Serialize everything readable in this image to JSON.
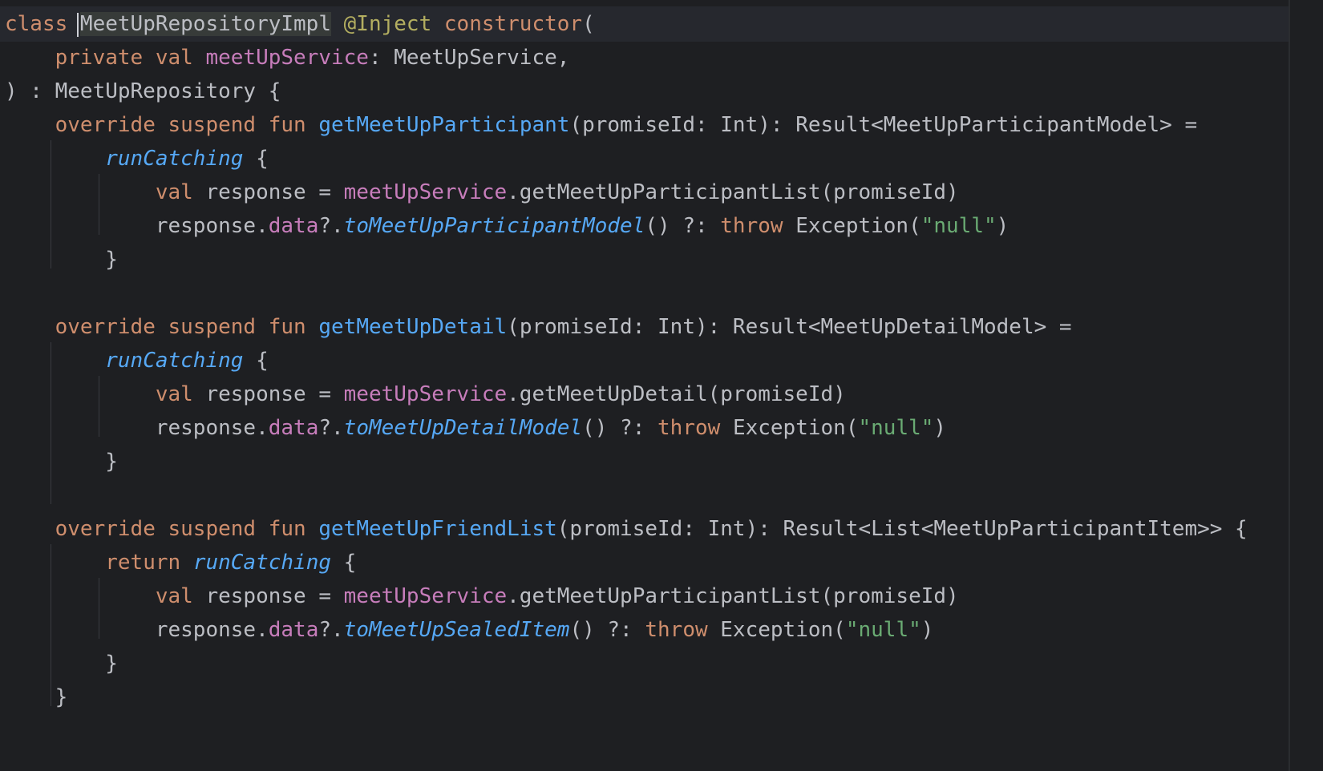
{
  "code_lines": [
    [
      {
        "t": "class ",
        "c": "kw"
      },
      {
        "t": "MeetUpRepositoryImpl",
        "c": "plain hl-word"
      },
      {
        "t": " ",
        "c": "plain"
      },
      {
        "t": "@Inject",
        "c": "ann"
      },
      {
        "t": " ",
        "c": "plain"
      },
      {
        "t": "constructor",
        "c": "kw"
      },
      {
        "t": "(",
        "c": "plain"
      }
    ],
    [
      {
        "t": "    ",
        "c": "plain"
      },
      {
        "t": "private val ",
        "c": "kw"
      },
      {
        "t": "meetUpService",
        "c": "prop"
      },
      {
        "t": ": MeetUpService,",
        "c": "plain"
      }
    ],
    [
      {
        "t": ") : MeetUpRepository {",
        "c": "plain"
      }
    ],
    [
      {
        "t": "    ",
        "c": "plain"
      },
      {
        "t": "override suspend fun ",
        "c": "kw"
      },
      {
        "t": "getMeetUpParticipant",
        "c": "fn"
      },
      {
        "t": "(promiseId: Int): Result<MeetUpParticipantModel> =",
        "c": "plain"
      }
    ],
    [
      {
        "t": "        ",
        "c": "plain"
      },
      {
        "t": "runCatching",
        "c": "ext"
      },
      {
        "t": " {",
        "c": "plain"
      }
    ],
    [
      {
        "t": "            ",
        "c": "plain"
      },
      {
        "t": "val ",
        "c": "kw"
      },
      {
        "t": "response = ",
        "c": "plain"
      },
      {
        "t": "meetUpService",
        "c": "prop"
      },
      {
        "t": ".getMeetUpParticipantList(promiseId)",
        "c": "plain"
      }
    ],
    [
      {
        "t": "            response.",
        "c": "plain"
      },
      {
        "t": "data",
        "c": "prop"
      },
      {
        "t": "?.",
        "c": "plain"
      },
      {
        "t": "toMeetUpParticipantModel",
        "c": "ext"
      },
      {
        "t": "() ?: ",
        "c": "plain"
      },
      {
        "t": "throw ",
        "c": "kw"
      },
      {
        "t": "Exception(",
        "c": "plain"
      },
      {
        "t": "\"null\"",
        "c": "str"
      },
      {
        "t": ")",
        "c": "plain"
      }
    ],
    [
      {
        "t": "        }",
        "c": "plain"
      }
    ],
    [],
    [
      {
        "t": "    ",
        "c": "plain"
      },
      {
        "t": "override suspend fun ",
        "c": "kw"
      },
      {
        "t": "getMeetUpDetail",
        "c": "fn"
      },
      {
        "t": "(promiseId: Int): Result<MeetUpDetailModel> =",
        "c": "plain"
      }
    ],
    [
      {
        "t": "        ",
        "c": "plain"
      },
      {
        "t": "runCatching",
        "c": "ext"
      },
      {
        "t": " {",
        "c": "plain"
      }
    ],
    [
      {
        "t": "            ",
        "c": "plain"
      },
      {
        "t": "val ",
        "c": "kw"
      },
      {
        "t": "response = ",
        "c": "plain"
      },
      {
        "t": "meetUpService",
        "c": "prop"
      },
      {
        "t": ".getMeetUpDetail(promiseId)",
        "c": "plain"
      }
    ],
    [
      {
        "t": "            response.",
        "c": "plain"
      },
      {
        "t": "data",
        "c": "prop"
      },
      {
        "t": "?.",
        "c": "plain"
      },
      {
        "t": "toMeetUpDetailModel",
        "c": "ext"
      },
      {
        "t": "() ?: ",
        "c": "plain"
      },
      {
        "t": "throw ",
        "c": "kw"
      },
      {
        "t": "Exception(",
        "c": "plain"
      },
      {
        "t": "\"null\"",
        "c": "str"
      },
      {
        "t": ")",
        "c": "plain"
      }
    ],
    [
      {
        "t": "        }",
        "c": "plain"
      }
    ],
    [],
    [
      {
        "t": "    ",
        "c": "plain"
      },
      {
        "t": "override suspend fun ",
        "c": "kw"
      },
      {
        "t": "getMeetUpFriendList",
        "c": "fn"
      },
      {
        "t": "(promiseId: Int): Result<List<MeetUpParticipantItem>> {",
        "c": "plain"
      }
    ],
    [
      {
        "t": "        ",
        "c": "plain"
      },
      {
        "t": "return ",
        "c": "kw"
      },
      {
        "t": "runCatching",
        "c": "ext"
      },
      {
        "t": " {",
        "c": "plain"
      }
    ],
    [
      {
        "t": "            ",
        "c": "plain"
      },
      {
        "t": "val ",
        "c": "kw"
      },
      {
        "t": "response = ",
        "c": "plain"
      },
      {
        "t": "meetUpService",
        "c": "prop"
      },
      {
        "t": ".getMeetUpParticipantList(promiseId)",
        "c": "plain"
      }
    ],
    [
      {
        "t": "            response.",
        "c": "plain"
      },
      {
        "t": "data",
        "c": "prop"
      },
      {
        "t": "?.",
        "c": "plain"
      },
      {
        "t": "toMeetUpSealedItem",
        "c": "ext"
      },
      {
        "t": "() ?: ",
        "c": "plain"
      },
      {
        "t": "throw ",
        "c": "kw"
      },
      {
        "t": "Exception(",
        "c": "plain"
      },
      {
        "t": "\"null\"",
        "c": "str"
      },
      {
        "t": ")",
        "c": "plain"
      }
    ],
    [
      {
        "t": "        }",
        "c": "plain"
      }
    ],
    [
      {
        "t": "    }",
        "c": "plain"
      }
    ]
  ]
}
